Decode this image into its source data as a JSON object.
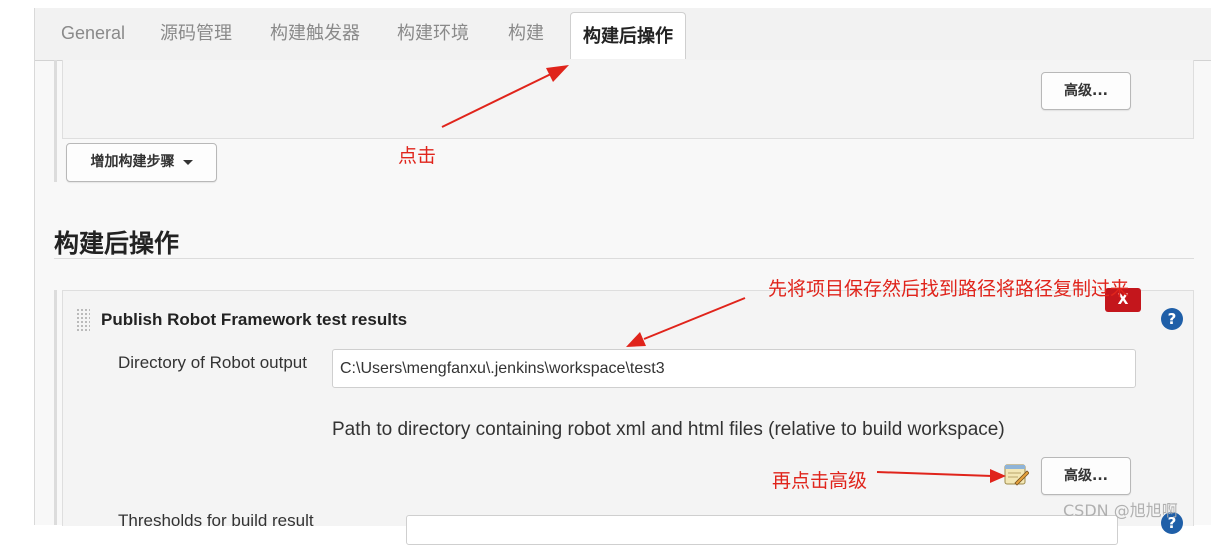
{
  "tabs": [
    {
      "label": "General"
    },
    {
      "label": "源码管理"
    },
    {
      "label": "构建触发器"
    },
    {
      "label": "构建环境"
    },
    {
      "label": "构建"
    },
    {
      "label": "构建后操作",
      "active": true
    }
  ],
  "build_step": {
    "advanced_label": "高级...",
    "add_step_label": "增加构建步骤"
  },
  "section": {
    "title": "构建后操作"
  },
  "publisher": {
    "title": "Publish Robot Framework test results",
    "delete_label": "X",
    "help_label": "?",
    "output_dir_label": "Directory of Robot output",
    "output_dir_value": "C:\\Users\\mengfanxu\\.jenkins\\workspace\\test3",
    "output_dir_description": "Path to directory containing robot xml and html files (relative to build workspace)",
    "advanced_label": "高级...",
    "thresholds_label": "Thresholds for build result"
  },
  "annotations": {
    "click_tab": "点击",
    "save_and_copy_path": "先将项目保存然后找到路径将路径复制过来",
    "click_advanced": "再点击高级"
  },
  "watermark": "CSDN @旭旭啊",
  "colors": {
    "annotation_red": "#e0241b",
    "delete_red": "#c4161c",
    "help_blue": "#1f5fa8"
  }
}
